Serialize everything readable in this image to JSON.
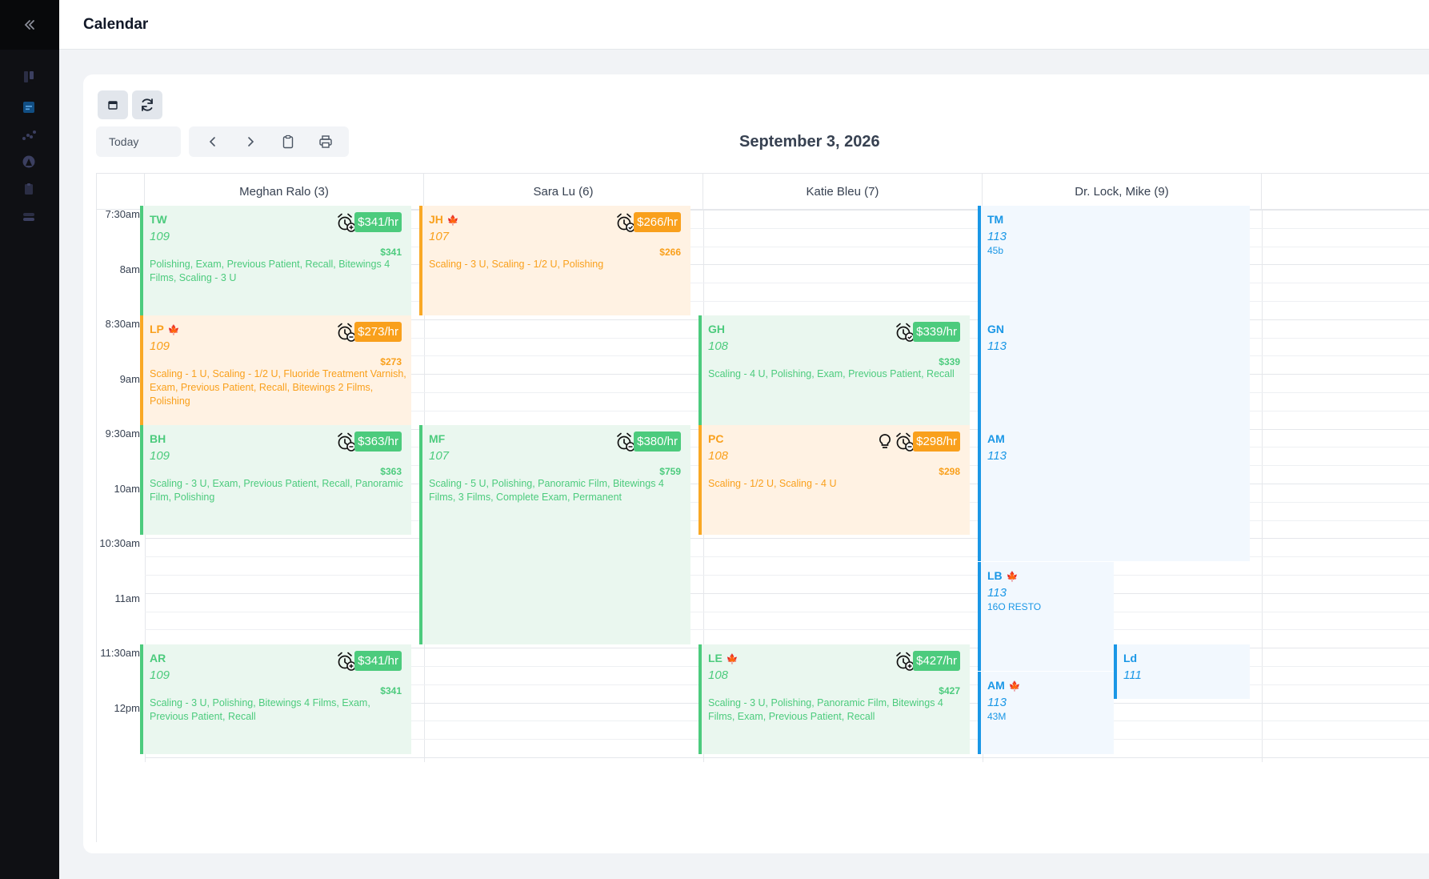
{
  "header": {
    "title": "Calendar"
  },
  "toolbar": {
    "today_label": "Today",
    "date": "September 3, 2026"
  },
  "columns": [
    {
      "name": "Meghan Ralo (3)"
    },
    {
      "name": "Sara Lu (6)"
    },
    {
      "name": "Katie Bleu (7)"
    },
    {
      "name": "Dr. Lock, Mike (9)"
    }
  ],
  "times": [
    "7:30am",
    "8am",
    "8:30am",
    "9am",
    "9:30am",
    "10am",
    "10:30am",
    "11am",
    "11:30am",
    "12pm"
  ],
  "appointments": [
    {
      "initials": "TW",
      "room": "109",
      "rate": "$341/hr",
      "amount": "$341",
      "procedures": "Polishing, Exam, Previous Patient, Recall, Bitewings 4 Films, Scaling - 3 U"
    },
    {
      "initials": "LP",
      "room": "109",
      "rate": "$273/hr",
      "amount": "$273",
      "procedures": "Scaling - 1 U, Scaling - 1/2 U, Fluoride Treatment Varnish, Exam, Previous Patient, Recall, Bitewings 2 Films, Polishing"
    },
    {
      "initials": "BH",
      "room": "109",
      "rate": "$363/hr",
      "amount": "$363",
      "procedures": "Scaling - 3 U, Exam, Previous Patient, Recall, Panoramic Film, Polishing"
    },
    {
      "initials": "AR",
      "room": "109",
      "rate": "$341/hr",
      "amount": "$341",
      "procedures": "Scaling - 3 U, Polishing, Bitewings 4 Films, Exam, Previous Patient, Recall"
    },
    {
      "initials": "JH",
      "room": "107",
      "rate": "$266/hr",
      "amount": "$266",
      "procedures": "Scaling - 3 U, Scaling - 1/2 U, Polishing"
    },
    {
      "initials": "MF",
      "room": "107",
      "rate": "$380/hr",
      "amount": "$759",
      "procedures": "Scaling - 5 U, Polishing, Panoramic Film, Bitewings 4 Films, 3 Films, Complete Exam, Permanent"
    },
    {
      "initials": "GH",
      "room": "108",
      "rate": "$339/hr",
      "amount": "$339",
      "procedures": "Scaling - 4 U, Polishing, Exam, Previous Patient, Recall"
    },
    {
      "initials": "PC",
      "room": "108",
      "rate": "$298/hr",
      "amount": "$298",
      "procedures": "Scaling - 1/2 U, Scaling - 4 U"
    },
    {
      "initials": "LE",
      "room": "108",
      "rate": "$427/hr",
      "amount": "$427",
      "procedures": "Scaling - 3 U, Polishing, Panoramic Film, Bitewings 4 Films, Exam, Previous Patient, Recall"
    },
    {
      "initials": "TM",
      "room": "113",
      "note": "45b"
    },
    {
      "initials": "GN",
      "room": "113"
    },
    {
      "initials": "AM",
      "room": "113"
    },
    {
      "initials": "LB",
      "room": "113",
      "note": "16O RESTO"
    },
    {
      "initials": "AM",
      "room": "113",
      "note": "43M"
    },
    {
      "initials": "Ld",
      "room": "111"
    }
  ],
  "colors": {
    "green": "#4ccb7d",
    "orange": "#f9a01c",
    "blue": "#1a97e6",
    "sidebar": "#0f1014"
  }
}
